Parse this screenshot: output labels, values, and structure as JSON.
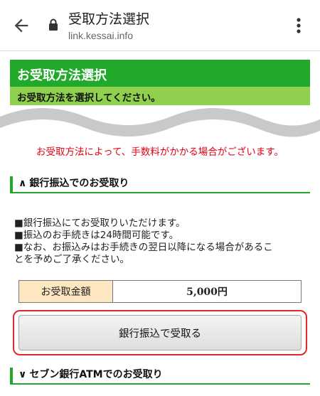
{
  "browser": {
    "title": "受取方法選択",
    "url": "link.kessai.info"
  },
  "header": {
    "title": "お受取方法選択",
    "subtitle": "お受取方法を選択してください。"
  },
  "notice": "お受取方法によって、手数料がかかる場合がございます。",
  "bank_section": {
    "chevron": "∧",
    "heading": "銀行振込でのお受取り",
    "lines": [
      "■銀行振込にてお受取りいただけます。",
      "■振込のお手続きは24時間可能です。",
      "■なお、お振込みはお手続きの翌日以降になる場合があるこ",
      "とを予めご了承ください。"
    ],
    "amount_label": "お受取金額",
    "amount_value": "5,000円",
    "button_label": "銀行振込で受取る"
  },
  "atm_section": {
    "chevron": "∨",
    "heading": "セブン銀行ATMでのお受取り"
  },
  "colors": {
    "brand_green": "#21a92c",
    "light_green": "#8fd14f",
    "notice_red": "#e60012",
    "highlight_red": "#e02828",
    "label_bg": "#fde7c0"
  }
}
